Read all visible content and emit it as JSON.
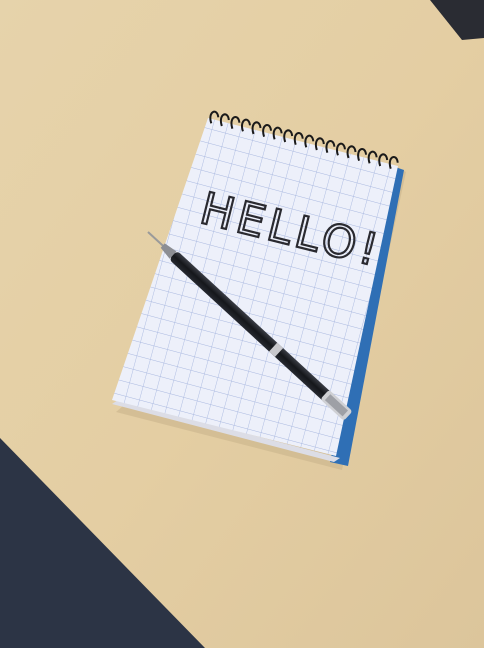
{
  "scene": {
    "description_free": true,
    "handwriting": "HELLO!",
    "colors": {
      "table": "#e2cea6",
      "paper": "#eef0f8",
      "grid": "#a9b8e0",
      "notebook_backing": "#2f6fb5",
      "pen": "#1d1f24",
      "floor": "#2c3445"
    }
  }
}
